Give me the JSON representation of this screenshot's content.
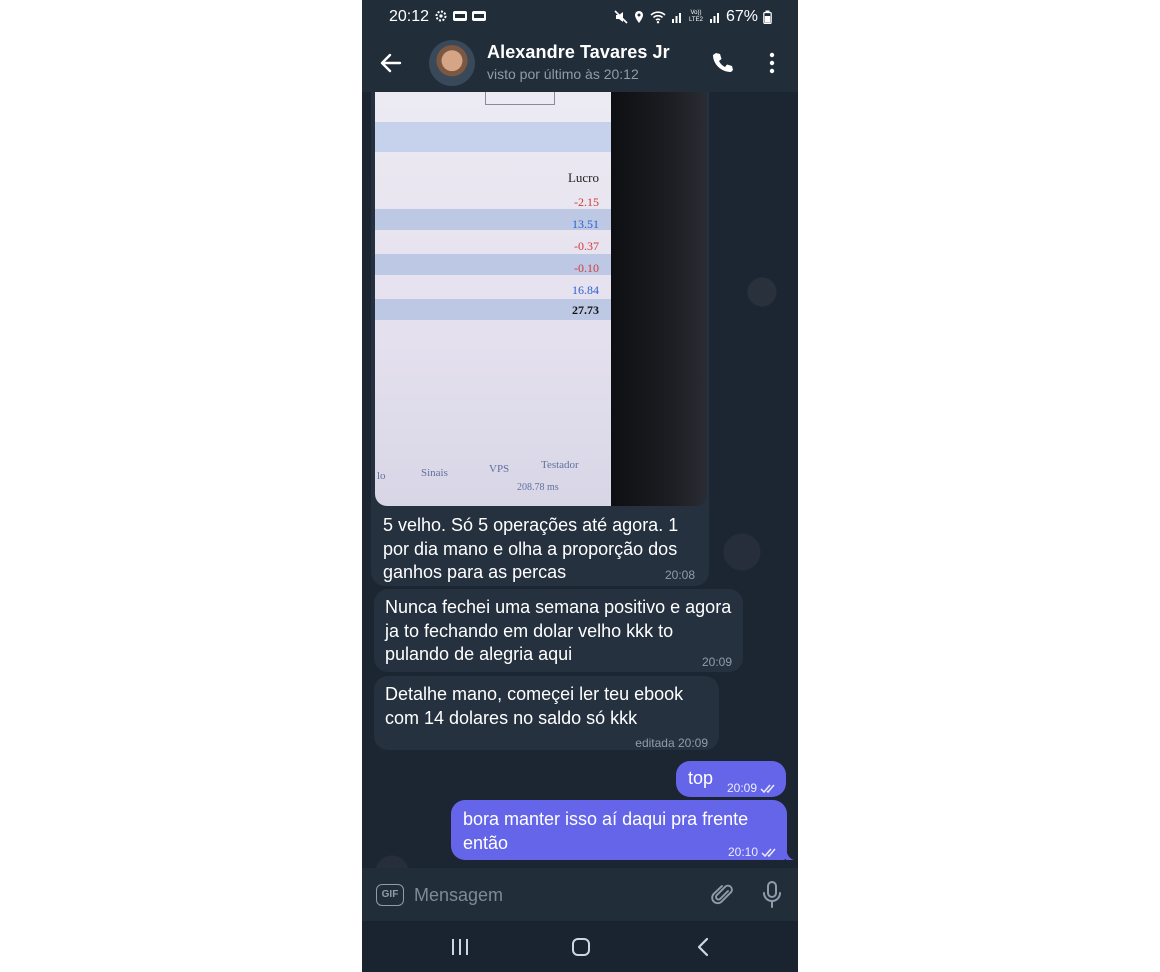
{
  "status_bar": {
    "time": "20:12",
    "battery": "67%",
    "network_label": "Vo)) LTE2"
  },
  "header": {
    "contact_name": "Alexandre Tavares Jr",
    "last_seen": "visto por último às 20:12",
    "back_icon": "arrow-left-icon",
    "call_icon": "phone-icon",
    "menu_icon": "more-vertical-icon"
  },
  "photo": {
    "column_header": "Lucro",
    "values": [
      "-2.15",
      "13.51",
      "-0.37",
      "-0.10",
      "16.84",
      "27.73"
    ],
    "bottom_tabs": [
      "lo",
      "Sinais",
      "VPS",
      "Testador"
    ],
    "ping": "208.78 ms"
  },
  "messages": [
    {
      "direction": "in",
      "text": "5 velho. Só 5 operações até agora. 1 por dia mano e olha a proporção dos ganhos para as percas",
      "time": "20:08"
    },
    {
      "direction": "in",
      "text": "Nunca fechei uma semana positivo e agora ja to fechando em dolar velho kkk to pulando de alegria aqui",
      "time": "20:09"
    },
    {
      "direction": "in",
      "text": "Detalhe mano, começei ler teu ebook com 14 dolares no saldo só kkk",
      "time": "editada 20:09"
    },
    {
      "direction": "out",
      "text": "top",
      "time": "20:09"
    },
    {
      "direction": "out",
      "text": "bora manter isso aí daqui pra frente então",
      "time": "20:10"
    }
  ],
  "input": {
    "gif_label": "GIF",
    "placeholder": "Mensagem"
  },
  "colors": {
    "outgoing_bubble": "#6465e9",
    "incoming_bubble": "#263140",
    "background": "#1c2632"
  }
}
